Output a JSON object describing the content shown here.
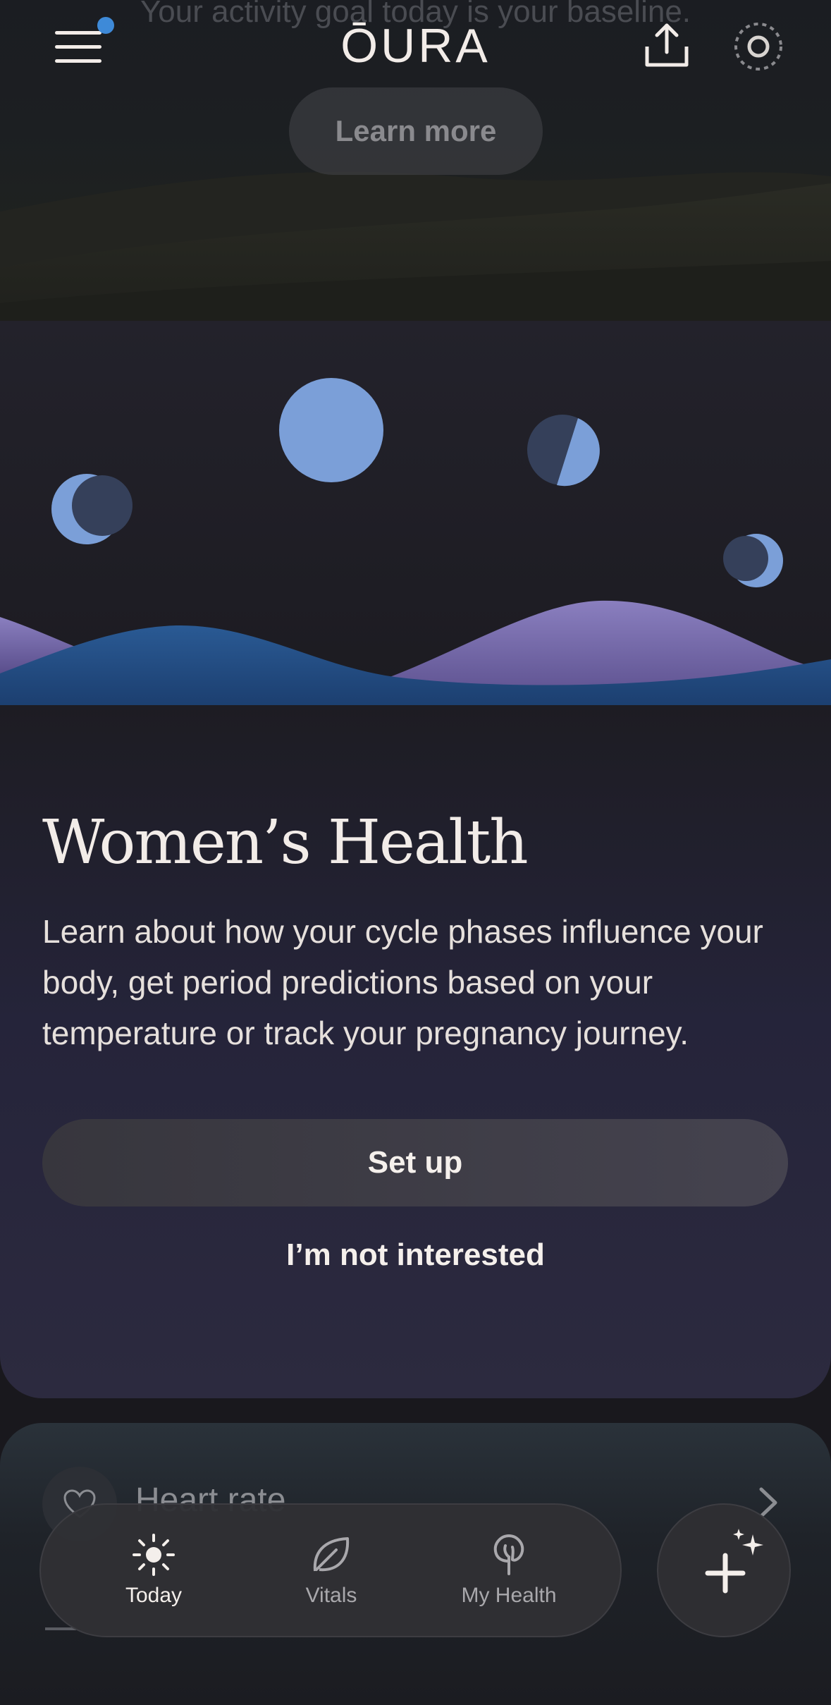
{
  "header": {
    "activity_goal_text": "Your activity goal today is your baseline.",
    "learn_more_label": "Learn more",
    "logo_text": "ŌURA",
    "menu_icon": "hamburger-menu-icon",
    "share_icon": "share-upload-icon",
    "ring_icon": "ring-status-icon",
    "notification_dot_color": "#3e8ad8"
  },
  "womens_health": {
    "title": "Women’s Health",
    "description": "Learn about how your cycle phases influence your body, get period predictions based on your temperature or track your pregnancy journey.",
    "setup_label": "Set up",
    "not_interested_label": "I’m not interested",
    "moon_color": "#7b9fd8",
    "wave_blue": "#1f4a7e",
    "wave_purple": "#8277b5"
  },
  "heart_rate": {
    "label": "Heart rate",
    "icon": "heart-icon"
  },
  "bottom_nav": {
    "items": [
      {
        "label": "Today",
        "icon": "sun-icon",
        "active": true
      },
      {
        "label": "Vitals",
        "icon": "leaf-icon",
        "active": false
      },
      {
        "label": "My Health",
        "icon": "tree-icon",
        "active": false
      }
    ],
    "fab_icon": "add-sparkle-icon"
  }
}
